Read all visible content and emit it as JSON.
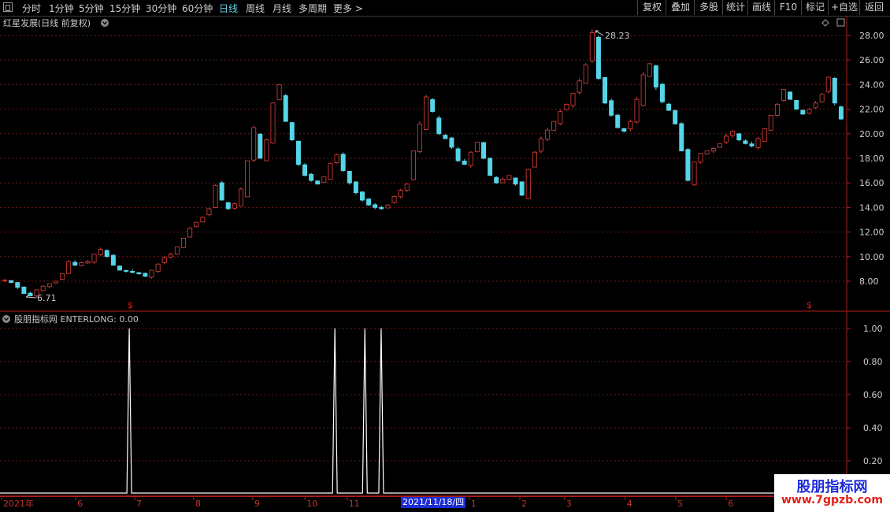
{
  "toolbar": {
    "periods": [
      "分时",
      "1分钟",
      "5分钟",
      "15分钟",
      "30分钟",
      "60分钟",
      "日线",
      "周线",
      "月线",
      "多周期",
      "更多 >"
    ],
    "active_period": "日线",
    "right_buttons": [
      "复权",
      "叠加",
      "多股",
      "统计",
      "画线",
      "F10",
      "标记",
      "+自选",
      "返回"
    ]
  },
  "main_chart": {
    "title": "红星发展(日线 前复权)",
    "max_label": "28.23",
    "min_label": "6.71",
    "y_ticks": [
      "28.00",
      "26.00",
      "24.00",
      "22.00",
      "20.00",
      "18.00",
      "16.00",
      "14.00",
      "12.00",
      "10.00",
      "8.00"
    ],
    "signal_marker": "$"
  },
  "indicator": {
    "title": "股朋指标网 ENTERLONG: 0.00",
    "y_ticks": [
      "1.00",
      "0.80",
      "0.60",
      "0.40",
      "0.20"
    ]
  },
  "date_axis": {
    "labels": [
      "2021年",
      "6",
      "7",
      "8",
      "9",
      "10",
      "11",
      "1",
      "2",
      "3",
      "4",
      "5",
      "6"
    ],
    "cursor_date": "2021/11/18/四"
  },
  "watermark": {
    "title": "股朋指标网",
    "url": "www.7gpzb.com"
  },
  "colors": {
    "up": "#e0403a",
    "down": "#54d6e8",
    "grid": "#6b1a14",
    "axis": "#b0201a",
    "active": "#6ad1e6"
  },
  "chart_data": {
    "type": "candlestick",
    "y_range": [
      6.0,
      28.5
    ],
    "close_path": [
      8.1,
      7.9,
      7.5,
      7.0,
      6.8,
      7.3,
      7.6,
      7.8,
      8.0,
      8.6,
      9.6,
      9.3,
      9.5,
      9.6,
      10.2,
      10.6,
      10.0,
      9.3,
      8.9,
      8.8,
      8.7,
      8.6,
      8.4,
      8.9,
      9.4,
      9.9,
      10.2,
      10.8,
      11.5,
      12.3,
      12.8,
      13.2,
      13.9,
      15.8,
      14.6,
      13.9,
      14.3,
      15.5,
      17.8,
      20.5,
      18.0,
      19.5,
      22.5,
      24.0,
      21.0,
      19.5,
      17.5,
      16.6,
      16.2,
      15.9,
      16.5,
      17.6,
      18.3,
      17.0,
      16.0,
      15.2,
      14.6,
      14.2,
      14.0,
      13.9,
      14.2,
      14.9,
      15.4,
      15.9,
      18.6,
      20.8,
      23.0,
      21.8,
      20.0,
      19.6,
      18.9,
      17.8,
      17.5,
      18.5,
      19.3,
      18.0,
      16.6,
      16.0,
      16.3,
      16.6,
      15.9,
      15.0,
      17.1,
      18.5,
      19.6,
      20.3,
      21.0,
      21.8,
      22.4,
      23.3,
      24.3,
      25.6,
      28.23,
      24.5,
      22.5,
      21.5,
      20.5,
      20.2,
      21.0,
      22.8,
      24.8,
      25.7,
      23.8,
      22.6,
      21.9,
      20.8,
      18.6,
      16.2,
      17.7,
      18.4,
      18.6,
      18.8,
      19.2,
      19.8,
      20.2,
      19.5,
      19.2,
      19.0,
      19.6,
      20.4,
      21.5,
      22.4,
      23.6,
      22.8,
      22.0,
      21.6,
      22.0,
      22.5,
      23.2,
      24.6,
      22.5,
      21.2
    ],
    "indicator_name": "ENTERLONG",
    "indicator_current": 0.0,
    "indicator_y_range": [
      0,
      1.05
    ],
    "indicator_spike_fraction_of_bars": [
      0.1515,
      0.3955,
      0.4311,
      0.4504
    ],
    "indicator_spike_value": 1.0
  }
}
